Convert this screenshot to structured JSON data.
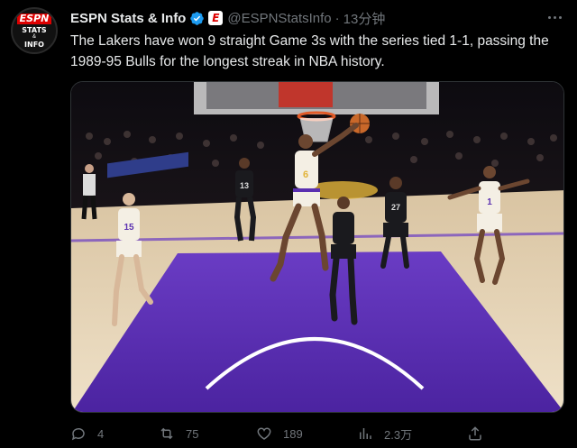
{
  "author": {
    "avatar_espn": "ESPN",
    "avatar_line1": "STATS",
    "avatar_amp": "&",
    "avatar_line2": "INFO",
    "name": "ESPN Stats & Info",
    "badge_letter": "E",
    "handle": "@ESPNStatsInfo",
    "separator": "·",
    "time": "13分钟"
  },
  "tweet": {
    "text": "The Lakers have won 9 straight Game 3s with the series tied 1-1, passing the 1989-95 Bulls for the longest streak in NBA history."
  },
  "media": {
    "jerseys": [
      "6",
      "13",
      "15",
      "1",
      "27"
    ]
  },
  "actions": {
    "reply_count": "4",
    "retweet_count": "75",
    "like_count": "189",
    "views_count": "2.3万"
  },
  "colors": {
    "verified": "#1d9bf0",
    "espn_red": "#d00000",
    "muted": "#71767b",
    "court_purple": "#5a2fb0",
    "court_wood": "#e8d6b8"
  }
}
